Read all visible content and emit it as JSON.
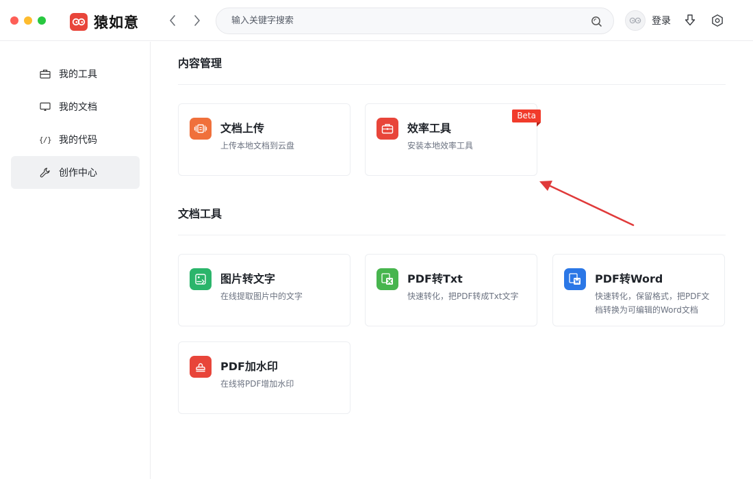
{
  "app": {
    "name": "猿如意",
    "colors": {
      "brand": "#e8453a",
      "accent_red": "#f13b2b"
    }
  },
  "titlebar": {
    "window_controls": [
      "close",
      "minimize",
      "maximize"
    ],
    "back_icon": "chevron-left-icon",
    "forward_icon": "chevron-right-icon",
    "search": {
      "placeholder": "输入关键字搜索",
      "value": "",
      "icon": "search-icon"
    },
    "user": {
      "login_label": "登录",
      "avatar_icon": "avatar-glasses-icon"
    },
    "download_icon": "download-icon",
    "settings_icon": "settings-icon"
  },
  "sidebar": {
    "items": [
      {
        "label": "我的工具",
        "icon": "toolbox-icon",
        "active": false
      },
      {
        "label": "我的文档",
        "icon": "monitor-icon",
        "active": false
      },
      {
        "label": "我的代码",
        "icon": "code-icon",
        "glyph": "{/}",
        "active": false
      },
      {
        "label": "创作中心",
        "icon": "wrench-icon",
        "active": true
      }
    ]
  },
  "main": {
    "sections": [
      {
        "title": "内容管理",
        "cards": [
          {
            "title": "文档上传",
            "desc": "上传本地文档到云盘",
            "icon": "upload-doc-icon",
            "color": "#f0703b"
          },
          {
            "title": "效率工具",
            "desc": "安装本地效率工具",
            "icon": "briefcase-icon",
            "color": "#e8453a",
            "badge": "Beta"
          }
        ]
      },
      {
        "title": "文档工具",
        "cards": [
          {
            "title": "图片转文字",
            "desc": "在线提取图片中的文字",
            "icon": "image-to-text-icon",
            "color": "#2bb56b"
          },
          {
            "title": "PDF转Txt",
            "desc": "快速转化，把PDF转成Txt文字",
            "icon": "excel-x-icon",
            "color": "#47b54e"
          },
          {
            "title": "PDF转Word",
            "desc": "快速转化，保留格式，把PDF文档转换为可编辑的Word文档",
            "icon": "word-w-icon",
            "color": "#2b77e6"
          },
          {
            "title": "PDF加水印",
            "desc": "在线将PDF增加水印",
            "icon": "stamp-icon",
            "color": "#e8453a"
          }
        ]
      }
    ]
  },
  "annotation": {
    "icon": "red-arrow-icon",
    "color": "#e03a3a"
  }
}
